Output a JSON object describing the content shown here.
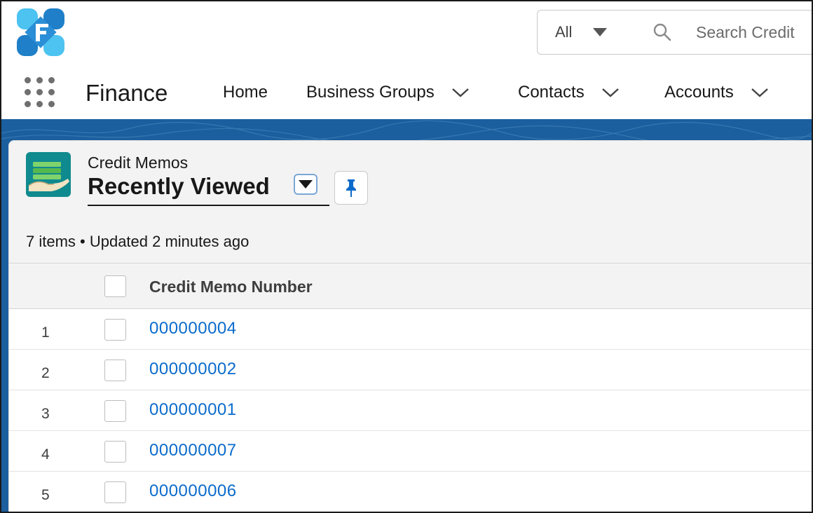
{
  "header": {
    "search_scope": "All",
    "search_placeholder": "Search Credit"
  },
  "nav": {
    "app_name": "Finance",
    "items": [
      {
        "label": "Home",
        "has_dropdown": false
      },
      {
        "label": "Business Groups",
        "has_dropdown": true
      },
      {
        "label": "Contacts",
        "has_dropdown": true
      },
      {
        "label": "Accounts",
        "has_dropdown": true
      }
    ]
  },
  "list_view": {
    "object_label": "Credit Memos",
    "view_name": "Recently Viewed",
    "status": "7 items • Updated 2 minutes ago",
    "columns": [
      "Credit Memo Number"
    ],
    "rows": [
      {
        "index": "1",
        "number": "000000004"
      },
      {
        "index": "2",
        "number": "000000002"
      },
      {
        "index": "3",
        "number": "000000001"
      },
      {
        "index": "4",
        "number": "000000007"
      },
      {
        "index": "5",
        "number": "000000006"
      }
    ]
  },
  "colors": {
    "brand_band": "#1b5f9e",
    "link": "#0b6bcb",
    "logo_light": "#4cc3f0",
    "logo_dark": "#1f7fc8",
    "object_icon_bg": "#0f8a8e"
  },
  "icons": [
    "app-logo-icon",
    "chevron-down-icon",
    "search-icon",
    "app-launcher-icon",
    "credit-memo-object-icon",
    "pin-icon"
  ]
}
